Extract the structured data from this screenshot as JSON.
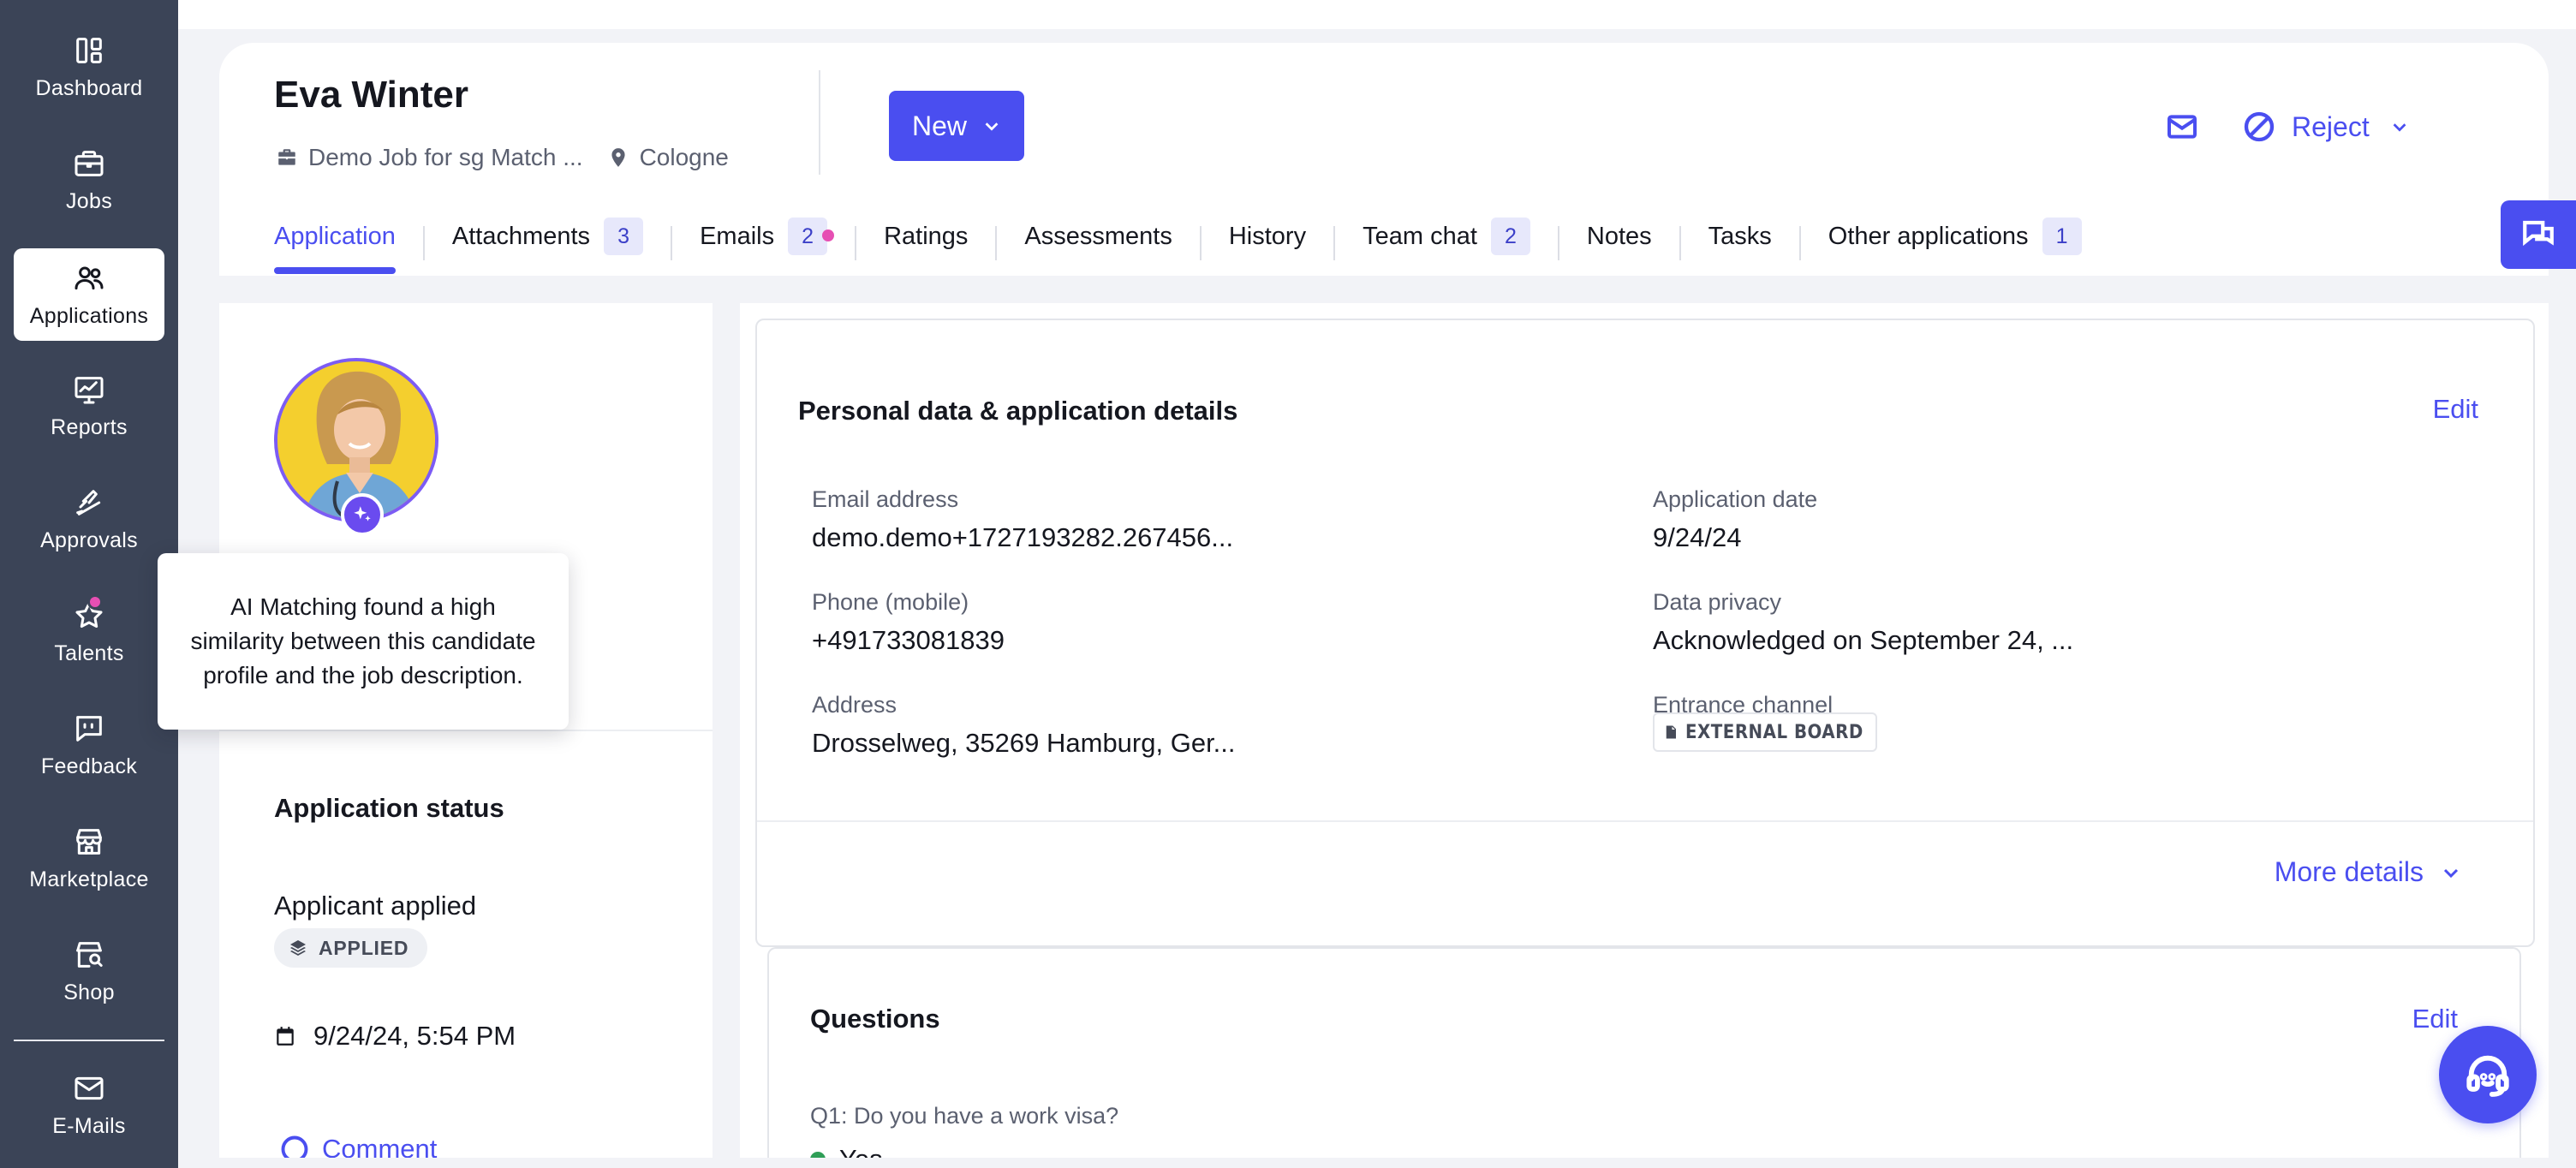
{
  "sidebar": {
    "items": [
      {
        "label": "Dashboard",
        "icon": "dashboard-icon"
      },
      {
        "label": "Jobs",
        "icon": "briefcase-icon"
      },
      {
        "label": "Applications",
        "icon": "users-icon",
        "active": true
      },
      {
        "label": "Reports",
        "icon": "chart-icon"
      },
      {
        "label": "Approvals",
        "icon": "thumbs-up-icon"
      },
      {
        "label": "Talents",
        "icon": "star-icon"
      },
      {
        "label": "Feedback",
        "icon": "feedback-icon"
      },
      {
        "label": "Marketplace",
        "icon": "store-icon"
      },
      {
        "label": "Shop",
        "icon": "shop-search-icon"
      },
      {
        "label": "E-Mails",
        "icon": "mail-icon"
      }
    ]
  },
  "candidate": {
    "name": "Eva Winter",
    "job": "Demo Job for sg Match ...",
    "location": "Cologne"
  },
  "header": {
    "status_button": "New",
    "reject_label": "Reject"
  },
  "tabs": [
    {
      "label": "Application",
      "active": true
    },
    {
      "label": "Attachments",
      "count": "3"
    },
    {
      "label": "Emails",
      "count": "2",
      "dot": true
    },
    {
      "label": "Ratings"
    },
    {
      "label": "Assessments"
    },
    {
      "label": "History"
    },
    {
      "label": "Team chat",
      "count": "2"
    },
    {
      "label": "Notes"
    },
    {
      "label": "Tasks"
    },
    {
      "label": "Other applications",
      "count": "1"
    }
  ],
  "tooltip": {
    "text": "AI Matching found a high similarity between this candidate profile and the job description."
  },
  "status": {
    "title": "Application status",
    "text": "Applicant applied",
    "chip": "APPLIED",
    "date": "9/24/24, 5:54 PM",
    "comment": "Comment"
  },
  "personal": {
    "title": "Personal data & application details",
    "edit": "Edit",
    "fields": {
      "email_label": "Email address",
      "email_value": "demo.demo+1727193282.267456...",
      "phone_label": "Phone (mobile)",
      "phone_value": "+491733081839",
      "address_label": "Address",
      "address_value": "Drosselweg, 35269 Hamburg, Ger...",
      "app_date_label": "Application date",
      "app_date_value": "9/24/24",
      "privacy_label": "Data privacy",
      "privacy_value": "Acknowledged on September 24, ...",
      "channel_label": "Entrance channel",
      "channel_value": "EXTERNAL BOARD"
    },
    "more": "More details"
  },
  "questions": {
    "title": "Questions",
    "edit": "Edit",
    "q1": "Q1: Do you have a work visa?",
    "q1_answer": "Yes"
  },
  "colors": {
    "accent": "#4a4ef0",
    "sidebar": "#3b4457",
    "notification": "#e64fb3",
    "ai": "#6a4bef"
  }
}
